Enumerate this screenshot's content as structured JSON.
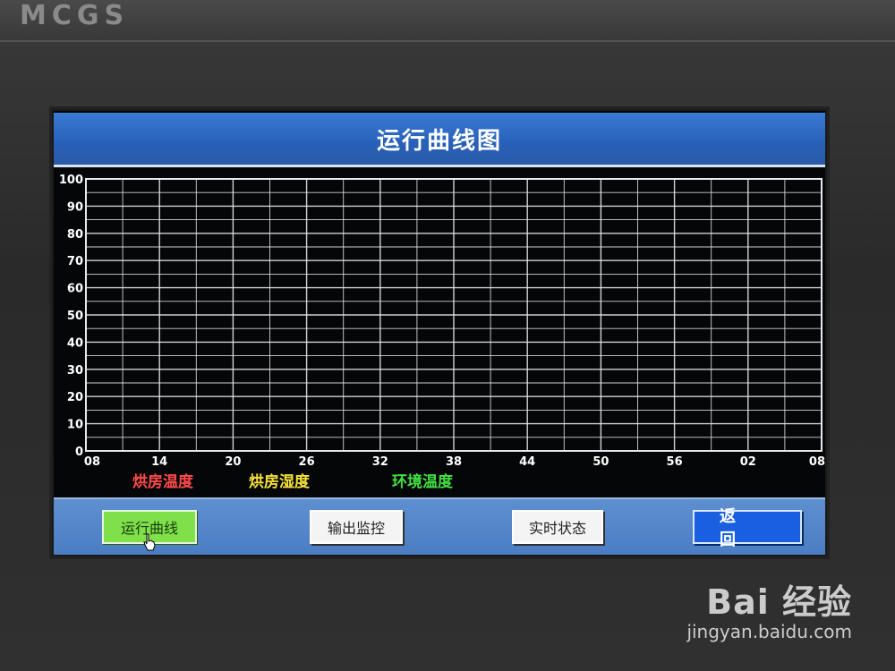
{
  "device": {
    "brand": "MCGS"
  },
  "window": {
    "title": "运行曲线图"
  },
  "chart_data": {
    "type": "line",
    "y_ticks": [
      "100",
      "90",
      "80",
      "70",
      "60",
      "50",
      "40",
      "30",
      "20",
      "10",
      "0"
    ],
    "x_ticks": [
      "08",
      "14",
      "20",
      "26",
      "32",
      "38",
      "44",
      "50",
      "56",
      "02",
      "08"
    ],
    "ylim": [
      0,
      100
    ],
    "grid": true,
    "series": [
      {
        "name": "烘房温度",
        "color": "#ff4a4a",
        "values": []
      },
      {
        "name": "烘房湿度",
        "color": "#f5e23a",
        "values": []
      },
      {
        "name": "环境温度",
        "color": "#43e043",
        "values": []
      }
    ],
    "legend_position": "bottom-left"
  },
  "toolbar": {
    "run_curve_label": "运行曲线",
    "output_monitor_label": "输出监控",
    "realtime_state_label": "实时状态",
    "back_label": "返回"
  },
  "watermark": {
    "logo": "Bai 经验",
    "url": "jingyan.baidu.com"
  },
  "colors": {
    "title_bar": "#2f6bc4",
    "bottom_bar": "#5287c9",
    "run_button_active": "#7fe04a",
    "back_button": "#1a5fe0",
    "grid_line": "#e8e8e8"
  }
}
